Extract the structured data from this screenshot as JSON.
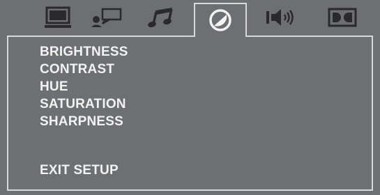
{
  "tabs": [
    {
      "icon": "monitor-icon",
      "active": false
    },
    {
      "icon": "speech-person-icon",
      "active": false
    },
    {
      "icon": "music-note-icon",
      "active": false
    },
    {
      "icon": "video-adjust-icon",
      "active": true
    },
    {
      "icon": "speaker-icon",
      "active": false
    },
    {
      "icon": "dolby-icon",
      "active": false
    }
  ],
  "menu": {
    "brightness": "BRIGHTNESS",
    "contrast": "CONTRAST",
    "hue": "HUE",
    "saturation": "SATURATION",
    "sharpness": "SHARPNESS",
    "exit": "EXIT SETUP"
  },
  "colors": {
    "background": "#6e6f72",
    "icon": "#2a2a2c",
    "text": "#f2f2f2",
    "border": "#d8d8d8"
  }
}
